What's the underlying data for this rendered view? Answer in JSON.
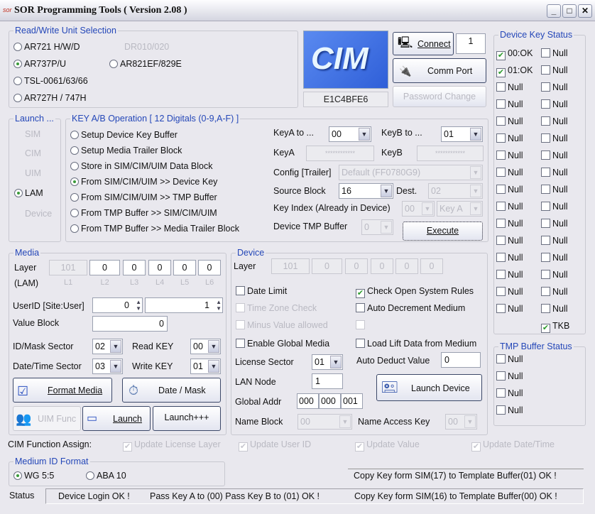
{
  "window": {
    "title": "SOR Programming Tools    ( Version 2.08 )",
    "minimize": "_",
    "maximize": "□",
    "close": "✕"
  },
  "colors": {
    "group_label": "#2447b8",
    "logo_bg": "#3d6fe0",
    "disabled_text": "#b9b9c2"
  },
  "rw": {
    "label": "Read/Write Unit Selection",
    "options": [
      {
        "label": "AR721 H/W/D",
        "checked": false
      },
      {
        "label": "AR737P/U",
        "checked": true
      },
      {
        "label": "TSL-0061/63/66",
        "checked": false
      },
      {
        "label": "AR727H / 747H",
        "checked": false
      },
      {
        "label": "AR821EF/829E",
        "checked": false
      },
      {
        "label": "DR010/020",
        "disabled": true
      }
    ]
  },
  "logo": {
    "text": "CIM",
    "serial": "E1C4BFE6"
  },
  "conn": {
    "connect": "Connect",
    "port_value": "1",
    "comm_port": "Comm Port",
    "password": "Password Change"
  },
  "launch": {
    "label": "Launch ...",
    "sim": "SIM",
    "cim": "CIM",
    "uim": "UIM",
    "lam": "LAM",
    "device": "Device"
  },
  "keyop": {
    "label": "KEY A/B Operation  [ 12 Digitals (0-9,A-F) ]",
    "options": [
      "Setup Device Key Buffer",
      "Setup Media Trailer Block",
      "Store in SIM/CIM/UIM Data Block",
      "From SIM/CIM/UIM  >> Device Key",
      "From SIM/CIM/UIM  >> TMP Buffer",
      "From TMP Buffer >> SIM/CIM/UIM",
      "From TMP Buffer >> Media Trailer Block"
    ],
    "selected": 3,
    "keya_to": "KeyA  to ...",
    "keya_to_val": "00",
    "keyb_to": "KeyB  to ...",
    "keyb_to_val": "01",
    "keya": "KeyA",
    "keya_val": "************",
    "keyb": "KeyB",
    "keyb_val": "************",
    "config": "Config [Trailer]",
    "config_val": "Default (FF0780G9)",
    "source": "Source Block",
    "source_val": "16",
    "dest": "Dest.",
    "dest_val": "02",
    "keyindex": "Key Index (Already in Device)",
    "keyindex_val": "00",
    "keyindex_key": "Key A",
    "tmp": "Device TMP Buffer",
    "tmp_val": "0",
    "execute": "Execute"
  },
  "media": {
    "label": "Media",
    "layer": "Layer",
    "lam": "(LAM)",
    "layers": [
      "101",
      "0",
      "0",
      "0",
      "0",
      "0"
    ],
    "layer_names": [
      "L1",
      "L2",
      "L3",
      "L4",
      "L5",
      "L6"
    ],
    "userid": "UserID [Site:User]",
    "site": "0",
    "user": "1",
    "value_block": "Value Block",
    "value": "0",
    "idmask": "ID/Mask Sector",
    "idmask_val": "02",
    "readkey": "Read KEY",
    "readkey_val": "00",
    "datetime": "Date/Time Sector",
    "datetime_val": "03",
    "writekey": "Write KEY",
    "writekey_val": "01",
    "format": "Format Media",
    "datemask": "Date / Mask",
    "uimfunc": "UIM Func",
    "launch": "Launch",
    "launchpp": "Launch+++"
  },
  "device": {
    "label": "Device",
    "layer": "Layer",
    "layers": [
      "101",
      "0",
      "0",
      "0",
      "0",
      "0"
    ],
    "date_limit": "Date Limit",
    "check_open": "Check Open System Rules",
    "time_zone": "Time Zone Check",
    "auto_dec": "Auto Decrement Medium",
    "minus": "Minus Value allowed",
    "enable_global": "Enable Global Media",
    "load_lift": "Load Lift Data from Medium",
    "license": "License Sector",
    "license_val": "01",
    "auto_deduct": "Auto Deduct Value",
    "auto_deduct_val": "0",
    "lan": "LAN Node",
    "lan_val": "1",
    "launch_device": "Launch Device",
    "global": "Global Addr",
    "global_vals": [
      "000",
      "000",
      "001"
    ],
    "name_block": "Name Block",
    "name_block_val": "00",
    "name_key": "Name Access Key",
    "name_key_val": "00"
  },
  "keystatus": {
    "label": "Device Key Status",
    "left": [
      "00:OK",
      "01:OK",
      "Null",
      "Null",
      "Null",
      "Null",
      "Null",
      "Null",
      "Null",
      "Null",
      "Null",
      "Null",
      "Null",
      "Null",
      "Null",
      "Null"
    ],
    "left_checked": [
      true,
      true,
      false,
      false,
      false,
      false,
      false,
      false,
      false,
      false,
      false,
      false,
      false,
      false,
      false,
      false
    ],
    "right": [
      "Null",
      "Null",
      "Null",
      "Null",
      "Null",
      "Null",
      "Null",
      "Null",
      "Null",
      "Null",
      "Null",
      "Null",
      "Null",
      "Null",
      "Null",
      "Null",
      "TKB"
    ],
    "right_checked": [
      false,
      false,
      false,
      false,
      false,
      false,
      false,
      false,
      false,
      false,
      false,
      false,
      false,
      false,
      false,
      false,
      true
    ]
  },
  "tmpstatus": {
    "label": "TMP Buffer Status",
    "items": [
      "Null",
      "Null",
      "Null",
      "Null"
    ]
  },
  "cimfunc": {
    "label": "CIM Function Assign:",
    "items": [
      "Update License Layer",
      "Update User ID",
      "Update Value",
      "Update Date/Time"
    ]
  },
  "idformat": {
    "label": "Medium ID Format",
    "wg": "WG 5:5",
    "aba": "ABA 10"
  },
  "status": {
    "label": "Status",
    "msg1": "Device Login OK !",
    "msg2": "Pass Key A to (00) Pass Key B to (01)  OK !",
    "msg3": "Copy Key form SIM(16) to Template Buffer(00) OK !",
    "top_msg": "Copy Key form SIM(17) to Template Buffer(01) OK !"
  }
}
